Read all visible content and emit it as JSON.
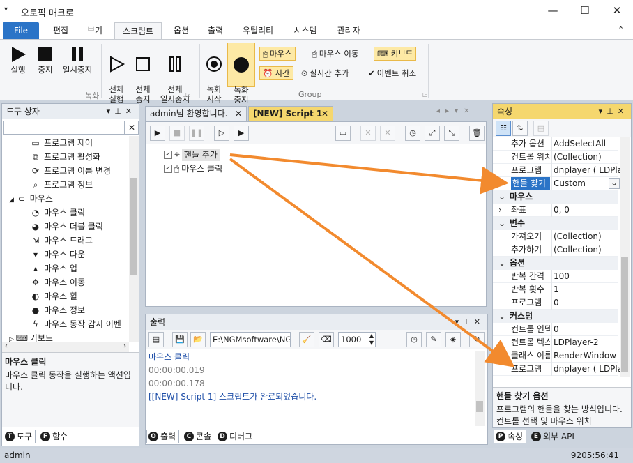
{
  "app": {
    "title": "오토픽 매크로",
    "version": "9205:56:41",
    "user": "admin"
  },
  "menu_tabs": [
    "File",
    "편집",
    "보기",
    "스크립트",
    "옵션",
    "출력",
    "유틸리티",
    "시스템",
    "관리자"
  ],
  "ribbon": {
    "record_group_label": "녹화",
    "group_label": "Group",
    "run": "실행",
    "stop": "중지",
    "pause": "일시중지",
    "run_all": "전체\n실행",
    "stop_all": "전체\n중지",
    "pause_all": "전체\n일시중지",
    "rec_start": "녹화\n시작",
    "rec_stop": "녹화\n중지",
    "mouse": "마우스",
    "mouse_move": "마우스 이동",
    "keyboard": "키보드",
    "time": "시간",
    "realtime_add": "실시간 추가",
    "event_cancel": "이벤트 취소"
  },
  "toolbox": {
    "title": "도구 상자",
    "search_placeholder": "",
    "items": [
      {
        "label": "프로그램 제어",
        "icon": "monitor-icon",
        "indent": 2
      },
      {
        "label": "프로그램 활성화",
        "icon": "window-activate-icon",
        "indent": 2
      },
      {
        "label": "프로그램 이름 변경",
        "icon": "rename-icon",
        "indent": 2
      },
      {
        "label": "프로그램 정보",
        "icon": "magnify-icon",
        "indent": 2
      },
      {
        "label": "마우스",
        "icon": "mouse-icon",
        "indent": 1,
        "expanded": true
      },
      {
        "label": "마우스 클릭",
        "icon": "mouse-click-icon",
        "indent": 2
      },
      {
        "label": "마우스 더블 클릭",
        "icon": "mouse-double-click-icon",
        "indent": 2
      },
      {
        "label": "마우스 드래그",
        "icon": "mouse-drag-icon",
        "indent": 2
      },
      {
        "label": "마우스 다운",
        "icon": "mouse-down-icon",
        "indent": 2
      },
      {
        "label": "마우스 업",
        "icon": "mouse-up-icon",
        "indent": 2
      },
      {
        "label": "마우스 이동",
        "icon": "move-arrows-icon",
        "indent": 2
      },
      {
        "label": "마우스 휠",
        "icon": "mouse-wheel-icon",
        "indent": 2
      },
      {
        "label": "마우스 정보",
        "icon": "mouse-info-icon",
        "indent": 2
      },
      {
        "label": "마우스 동작 감지 이벤",
        "icon": "lightning-icon",
        "indent": 2
      },
      {
        "label": "키보드",
        "icon": "keyboard-icon",
        "indent": 1,
        "expanded": false
      }
    ],
    "desc_title": "마우스 클릭",
    "desc_text": "마우스 클릭 동작을 실행하는 액션입니다.",
    "bottom_tabs": [
      {
        "letter": "T",
        "label": "도구"
      },
      {
        "letter": "F",
        "label": "함수"
      }
    ]
  },
  "documents": {
    "tabs": [
      {
        "label": "admin님 환영합니다."
      },
      {
        "label": "[NEW] Script 1"
      }
    ],
    "script_items": [
      {
        "label": "핸들 추가",
        "checked": true
      },
      {
        "label": "마우스 클릭",
        "checked": true
      }
    ]
  },
  "output": {
    "title": "출력",
    "path": "E:\\NGMsoftware\\NG",
    "count": "1000",
    "lines": [
      {
        "text": "마우스 클릭",
        "color": "#1f4fa8"
      },
      {
        "text": "00:00:00.019",
        "color": "#7a7a7a"
      },
      {
        "text": "00:00:00.178",
        "color": "#7a7a7a"
      },
      {
        "text": "[[NEW] Script 1] 스크립트가 완료되었습니다.",
        "color": "#1f4fa8"
      }
    ],
    "bottom_tabs": [
      {
        "letter": "O",
        "label": "출력"
      },
      {
        "letter": "C",
        "label": "콘솔"
      },
      {
        "letter": "D",
        "label": "디버그"
      }
    ]
  },
  "properties": {
    "title": "속성",
    "rows": [
      {
        "type": "row",
        "key": "추가 옵션",
        "value": "AddSelectAll"
      },
      {
        "type": "row",
        "key": "컨트롤 위치",
        "value": "(Collection)"
      },
      {
        "type": "row",
        "key": "프로그램",
        "value": "dnplayer ( LDPlayer"
      },
      {
        "type": "row",
        "key": "핸들 찾기",
        "value": "Custom",
        "selected": true
      },
      {
        "type": "cat",
        "key": "마우스"
      },
      {
        "type": "row",
        "key": "좌표",
        "value": "0, 0",
        "expander": true
      },
      {
        "type": "cat",
        "key": "변수"
      },
      {
        "type": "row",
        "key": "가져오기",
        "value": "(Collection)"
      },
      {
        "type": "row",
        "key": "추가하기",
        "value": "(Collection)"
      },
      {
        "type": "cat",
        "key": "옵션"
      },
      {
        "type": "row",
        "key": "반복 간격",
        "value": "100"
      },
      {
        "type": "row",
        "key": "반복 횟수",
        "value": "1"
      },
      {
        "type": "row",
        "key": "프로그램",
        "value": "0"
      },
      {
        "type": "cat",
        "key": "커스텀"
      },
      {
        "type": "row",
        "key": "컨트롤 인덱스",
        "value": "0"
      },
      {
        "type": "row",
        "key": "컨트롤 텍스트",
        "value": "LDPlayer-2"
      },
      {
        "type": "row",
        "key": "클래스 이름",
        "value": "RenderWindow"
      },
      {
        "type": "row",
        "key": "프로그램",
        "value": "dnplayer ( LDPla"
      }
    ],
    "desc_title": "핸들 찾기 옵션",
    "desc_text": "프로그램의 핸들을 찾는 방식입니다. 컨트롤 선택 및 마우스 위치",
    "bottom_tabs": [
      {
        "letter": "P",
        "label": "속성"
      },
      {
        "letter": "E",
        "label": "외부 API"
      }
    ]
  },
  "colors": {
    "accent": "#2b74c7",
    "highlight": "#f5d76e",
    "arrow": "#f28a2e"
  }
}
